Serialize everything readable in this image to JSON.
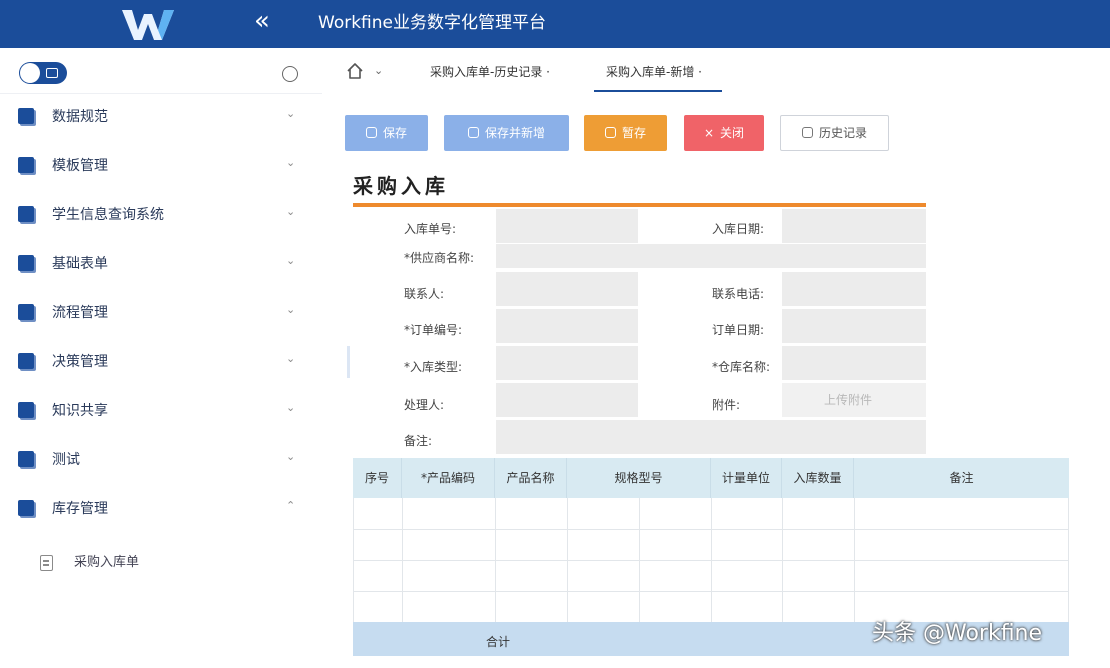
{
  "header": {
    "collapse_glyph": "«",
    "title": "Workfine业务数字化管理平台"
  },
  "sidebar": {
    "items": [
      {
        "label": "数据规范",
        "chevron": "⌄"
      },
      {
        "label": "模板管理",
        "chevron": "⌄"
      },
      {
        "label": "学生信息查询系统",
        "chevron": "⌄"
      },
      {
        "label": "基础表单",
        "chevron": "⌄"
      },
      {
        "label": "流程管理",
        "chevron": "⌄"
      },
      {
        "label": "决策管理",
        "chevron": "⌄"
      },
      {
        "label": "知识共享",
        "chevron": "⌄"
      },
      {
        "label": "测试",
        "chevron": "⌄"
      },
      {
        "label": "库存管理",
        "chevron": "⌃"
      }
    ],
    "sub_item": {
      "label": "采购入库单"
    }
  },
  "breadcrumb": {
    "home_chevron": "⌄",
    "tabs": [
      {
        "label": "采购入库单-历史记录 ·"
      },
      {
        "label": "采购入库单-新增 ·"
      }
    ]
  },
  "toolbar": {
    "save": "保存",
    "save_new": "保存并新增",
    "hold": "暂存",
    "close_icon": "×",
    "close": "关闭",
    "history": "历史记录"
  },
  "form": {
    "title": "采购入库",
    "fields": {
      "inbound_no": "入库单号:",
      "inbound_date": "入库日期:",
      "supplier": "*供应商名称:",
      "contact": "联系人:",
      "phone": "联系电话:",
      "order_no": "*订单编号:",
      "order_date": "订单日期:",
      "inbound_type": "*入库类型:",
      "warehouse": "*仓库名称:",
      "handler": "处理人:",
      "attachment": "附件:",
      "attachment_hint": "上传附件",
      "remark": "备注:"
    }
  },
  "table": {
    "headers": [
      "序号",
      "*产品编码",
      "产品名称",
      "规格型号",
      "计量单位",
      "入库数量",
      "备注"
    ],
    "footer": "合计"
  },
  "watermark": "头条 @Workfine",
  "colors": {
    "header_bg": "#1b4d9a",
    "save_btn": "#8bb0e8",
    "hold_btn": "#ee9d35",
    "close_btn": "#f06368",
    "accent_bar": "#ee8a2d",
    "table_head": "#d8eaf2"
  }
}
